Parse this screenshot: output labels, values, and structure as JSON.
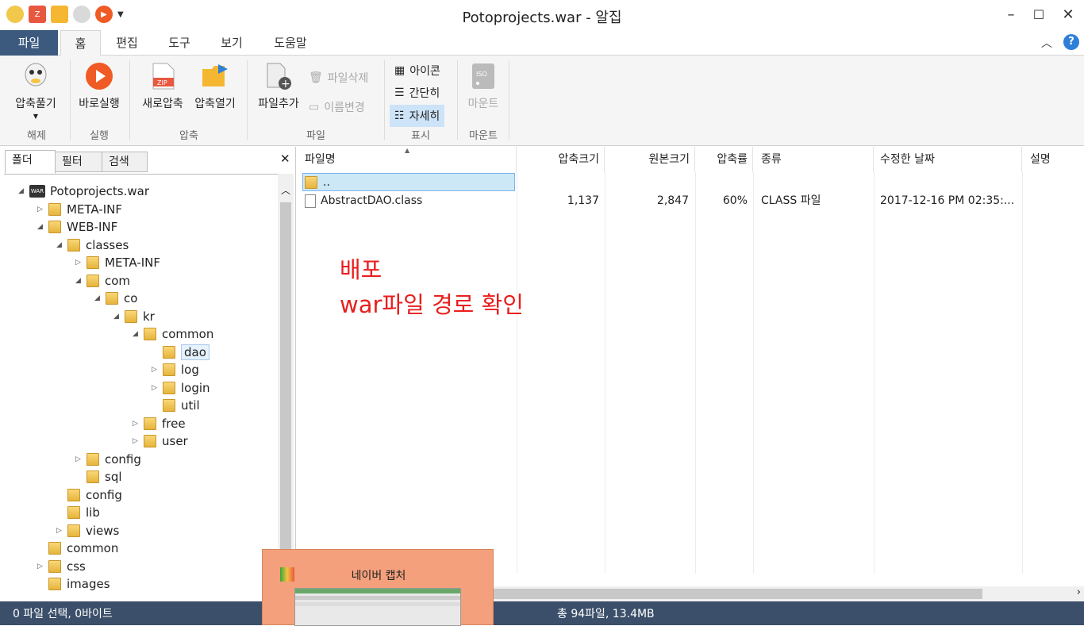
{
  "window": {
    "title": "Potoprojects.war - 알집"
  },
  "quick_access": [
    "app-icon",
    "zip-icon",
    "folder-open-icon",
    "extract-icon",
    "run-icon"
  ],
  "menu": {
    "file": "파일",
    "tabs": [
      "홈",
      "편집",
      "도구",
      "보기",
      "도움말"
    ]
  },
  "ribbon": {
    "extract": "압축풀기",
    "run": "바로실행",
    "new_zip": "새로압축",
    "open_zip": "압축열기",
    "add_file": "파일추가",
    "delete_file": "파일삭제",
    "rename": "이름변경",
    "view_icon": "아이콘",
    "view_simple": "간단히",
    "view_detail": "자세히",
    "mount": "마운트",
    "iso": "ISO",
    "zip_badge": "ZIP",
    "groups": {
      "extract": "해제",
      "run": "실행",
      "compress": "압축",
      "file": "파일",
      "view": "표시",
      "mount": "마운트"
    }
  },
  "left_tabs": [
    "폴더",
    "필터",
    "검색"
  ],
  "tree": [
    "Potoprojects.war",
    "META-INF",
    "WEB-INF",
    "classes",
    "META-INF",
    "com",
    "co",
    "kr",
    "common",
    "dao",
    "log",
    "login",
    "util",
    "free",
    "user",
    "config",
    "sql",
    "config",
    "lib",
    "views",
    "common",
    "css",
    "images"
  ],
  "tree_war_badge": "WAR",
  "columns": [
    "파일명",
    "압축크기",
    "원본크기",
    "압축률",
    "종류",
    "수정한 날짜",
    "설명"
  ],
  "rows": [
    {
      "name": "..",
      "packed": "",
      "size": "",
      "ratio": "",
      "type": "",
      "date": ""
    },
    {
      "name": "AbstractDAO.class",
      "packed": "1,137",
      "size": "2,847",
      "ratio": "60%",
      "type": "CLASS 파일",
      "date": "2017-12-16 PM 02:35:..."
    }
  ],
  "annotation": {
    "line1": "배포",
    "line2": "war파일 경로 확인"
  },
  "status": {
    "selected": "0 파일 선택, 0바이트",
    "total": "총 94파일, 13.4MB"
  },
  "capture_popup": {
    "title": "네이버 캡처"
  },
  "colors": {
    "accent": "#3c5a7e",
    "status_bar": "#3b4f6a",
    "annotation": "#e81e1e",
    "selection": "#cce8f6"
  }
}
